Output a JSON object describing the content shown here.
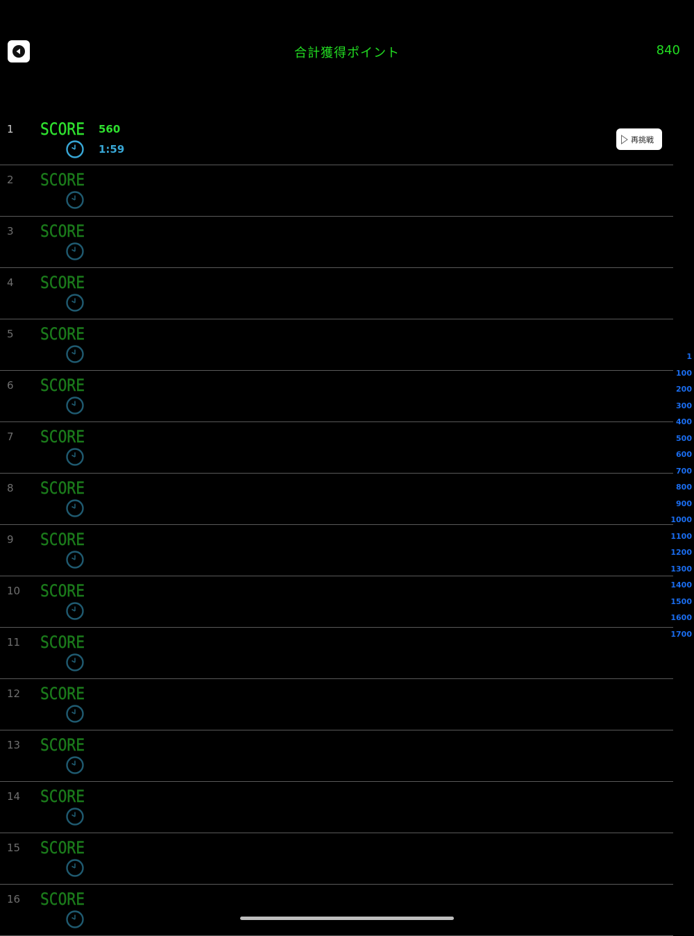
{
  "header": {
    "title": "合計獲得ポイント",
    "total_points": "840"
  },
  "colors": {
    "score_green": "#2fe02f",
    "score_dim": "#1b7a1b",
    "clock_blue": "#38a7d6",
    "clock_dim": "#1f5a70",
    "index_blue": "#1a6df0"
  },
  "score_icon_text": "SCORE",
  "retry_label": "再挑戦",
  "rows": [
    {
      "rank": "1",
      "score": "560",
      "time": "1:59"
    },
    {
      "rank": "2"
    },
    {
      "rank": "3"
    },
    {
      "rank": "4"
    },
    {
      "rank": "5"
    },
    {
      "rank": "6"
    },
    {
      "rank": "7"
    },
    {
      "rank": "8"
    },
    {
      "rank": "9"
    },
    {
      "rank": "10"
    },
    {
      "rank": "11"
    },
    {
      "rank": "12"
    },
    {
      "rank": "13"
    },
    {
      "rank": "14"
    },
    {
      "rank": "15"
    },
    {
      "rank": "16"
    }
  ],
  "index_items": [
    "1",
    "100",
    "200",
    "300",
    "400",
    "500",
    "600",
    "700",
    "800",
    "900",
    "1000",
    "1100",
    "1200",
    "1300",
    "1400",
    "1500",
    "1600",
    "1700"
  ]
}
